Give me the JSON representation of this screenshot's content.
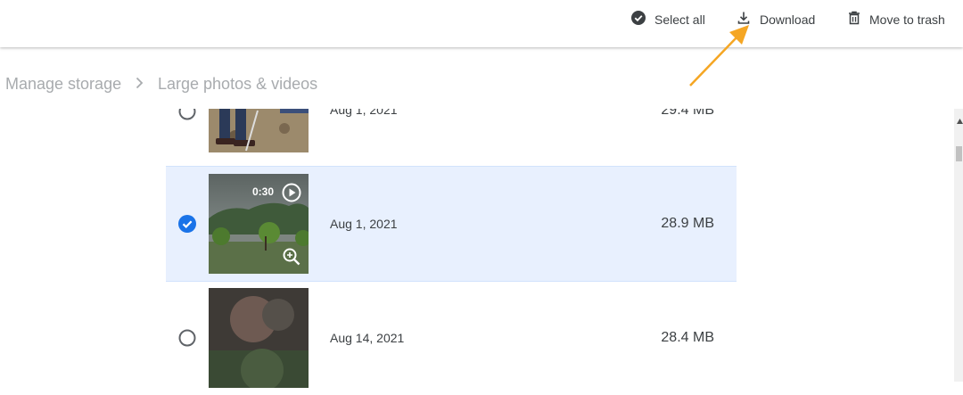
{
  "toolbar": {
    "select_all_label": "Select all",
    "download_label": "Download",
    "trash_label": "Move to trash"
  },
  "breadcrumb": {
    "parent": "Manage storage",
    "current": "Large photos & videos"
  },
  "items": [
    {
      "date": "Aug 1, 2021",
      "size": "29.4 MB",
      "selected": false
    },
    {
      "date": "Aug 1, 2021",
      "size": "28.9 MB",
      "selected": true,
      "duration": "0:30"
    },
    {
      "date": "Aug 14, 2021",
      "size": "28.4 MB",
      "selected": false
    }
  ],
  "colors": {
    "accent": "#1a73e8",
    "selected_row": "#e8f0fe",
    "annotation": "#f5a623"
  },
  "icons": [
    "check-circle-icon",
    "download-icon",
    "trash-icon",
    "chevron-right-icon",
    "play-icon",
    "zoom-in-icon"
  ]
}
